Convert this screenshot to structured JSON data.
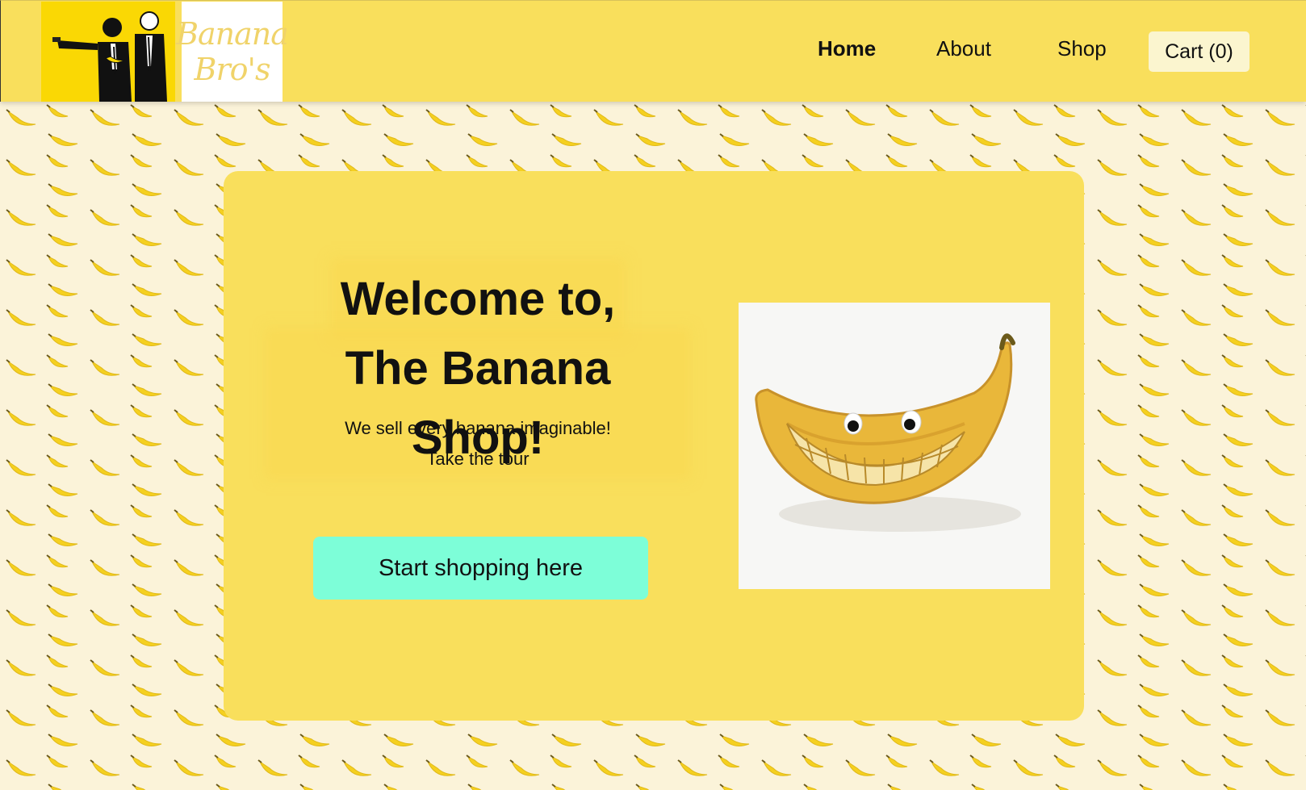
{
  "header": {
    "logo_line1": "Banana",
    "logo_line2": "Bro's",
    "nav": {
      "home": "Home",
      "about": "About",
      "shop": "Shop",
      "cart": "Cart (0)"
    }
  },
  "hero": {
    "title_line1": "Welcome to,",
    "title_line2": "The Banana Shop!",
    "subtitle_line1": "We sell every banana imaginable!",
    "subtitle_line2": "Take the tour",
    "cta_label": "Start shopping here"
  },
  "colors": {
    "header_bg": "#f9df5c",
    "hero_bg": "#f9df5c",
    "page_bg": "#fbf3d9",
    "cart_bg": "#fbf5cf",
    "cta_bg": "#7dfed8",
    "banana": "#f5d020",
    "logo_yellow": "#fad804"
  },
  "icons": {
    "logo_illustration": "two-figures-logo-illustration",
    "hero_image": "smiling-banana-photo"
  }
}
